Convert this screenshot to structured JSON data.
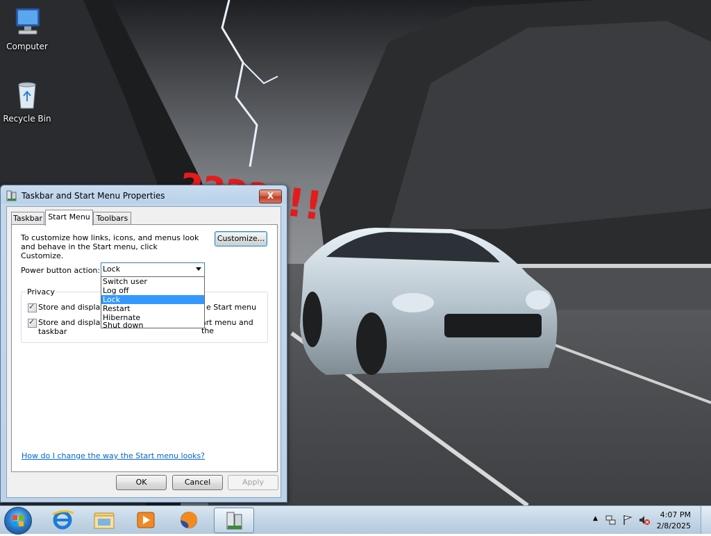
{
  "desktop": {
    "icons": [
      {
        "label": "Computer",
        "icon": "computer-icon"
      },
      {
        "label": "Recycle Bin",
        "icon": "recycle-bin-icon"
      }
    ],
    "wallpaper_graffiti": "????!!!"
  },
  "dialog": {
    "title": "Taskbar and Start Menu Properties",
    "close_label": "X",
    "tabs": [
      {
        "label": "Taskbar",
        "active": false
      },
      {
        "label": "Start Menu",
        "active": true
      },
      {
        "label": "Toolbars",
        "active": false
      }
    ],
    "description": "To customize how links, icons, and menus look and behave in the Start menu, click Customize.",
    "customize_label": "Customize...",
    "power_button": {
      "label": "Power button action:",
      "value": "Lock",
      "options": [
        "Switch user",
        "Log off",
        "Lock",
        "Restart",
        "Hibernate",
        "Shut down"
      ],
      "highlighted": "Lock"
    },
    "privacy": {
      "legend": "Privacy",
      "checkbox1_visible_start": "Store and display r",
      "checkbox1_visible_end": "e Start menu",
      "checkbox2_visible_start": "Store and display r",
      "checkbox2_visible_end": "art menu and the",
      "checkbox2_line2": "taskbar",
      "checkbox1_checked": true,
      "checkbox2_checked": true
    },
    "help_link": "How do I change the way the Start menu looks?",
    "ok_label": "OK",
    "cancel_label": "Cancel",
    "apply_label": "Apply"
  },
  "taskbar": {
    "pinned": [
      "internet-explorer-icon",
      "windows-explorer-icon",
      "media-player-icon",
      "firefox-icon",
      "taskbar-properties-icon"
    ],
    "tray": {
      "time": "4:07 PM",
      "date": "2/8/2025"
    }
  },
  "colors": {
    "selection": "#3399ff",
    "link": "#0066cc",
    "close_button": "#c0391f"
  }
}
